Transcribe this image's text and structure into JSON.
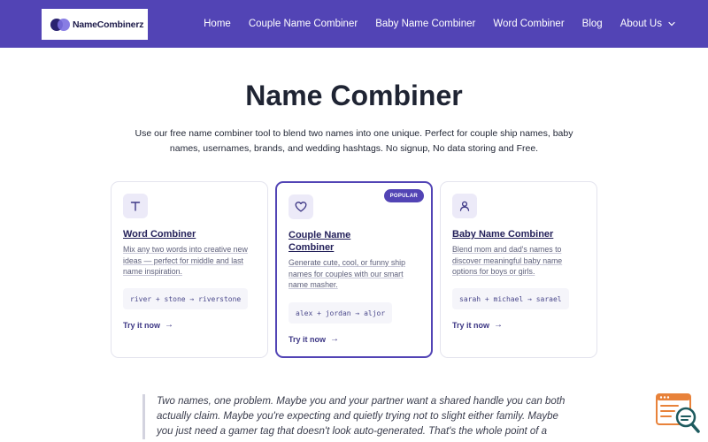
{
  "brand": {
    "name": "NameCombinerz",
    "primary_color": "#5244b5",
    "dark_color": "#2a2370",
    "light_color": "#7b6fe0"
  },
  "nav": {
    "items": [
      {
        "label": "Home"
      },
      {
        "label": "Couple Name Combiner"
      },
      {
        "label": "Baby Name Combiner"
      },
      {
        "label": "Word Combiner"
      },
      {
        "label": "Blog"
      },
      {
        "label": "About Us",
        "icon": "chevron-down-icon"
      }
    ]
  },
  "hero": {
    "title": "Name Combiner",
    "description_line1": "Use our free name combiner tool to blend two names into one unique. Perfect for couple ship names, baby",
    "description_line2": "names, usernames, brands, and wedding hashtags. No signup, No data storing and Free."
  },
  "cards": [
    {
      "icon": "text-t-icon",
      "title": "Word Combiner",
      "description": [
        "Mix any two words into creative new",
        "ideas — perfect for middle and last",
        "name inspiration."
      ],
      "example": "river + stone → riverstone",
      "cta": "Try it now"
    },
    {
      "icon": "heart-icon",
      "badge": "POPULAR",
      "title_line1": "Couple Name",
      "title_line2": "Combiner",
      "description": [
        "Generate cute, cool, or funny ship",
        "names for couples with our smart",
        "name masher."
      ],
      "example": "alex + jordan → aljor",
      "cta": "Try it now"
    },
    {
      "icon": "user-icon",
      "title": "Baby Name Combiner",
      "description": [
        "Blend mom and dad's names to",
        "discover meaningful baby name",
        "options for boys or girls."
      ],
      "example": "sarah + michael → sarael",
      "cta": "Try it now"
    }
  ],
  "quote": {
    "line1": "Two names, one problem. Maybe you and your partner want a shared handle you can both",
    "line2": "actually claim. Maybe you're expecting and quietly trying not to slight either family. Maybe",
    "line3": "you just need a gamer tag that doesn't look auto-generated. That's the whole point of a"
  },
  "widget": {
    "icon": "search-document-icon",
    "accent": "#e8823a",
    "dark": "#1d5a5e"
  }
}
